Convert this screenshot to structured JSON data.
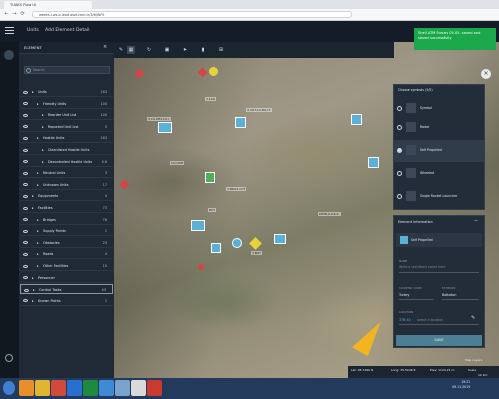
{
  "browser": {
    "tab_title": "TUAKS Flow UI",
    "url": "weeks.r.ws.b.lead.aser.com.tr/3/6/WFS"
  },
  "appbar": {
    "menu_items": [
      "Units",
      "Add Element",
      "Detail"
    ]
  },
  "panel": {
    "title": "ELEMENT",
    "search_placeholder": "Search",
    "rows": [
      {
        "label": "Units",
        "count": "163",
        "depth": 0
      },
      {
        "label": "Friendly Units",
        "count": "100",
        "depth": 1
      },
      {
        "label": "Reorder Unit List",
        "count": "100",
        "depth": 2
      },
      {
        "label": "Reported Unit List",
        "count": "0",
        "depth": 2
      },
      {
        "label": "Hostile Units",
        "count": "163",
        "depth": 1
      },
      {
        "label": "Cleanlisted Hostile Units",
        "count": "",
        "depth": 2
      },
      {
        "label": "Decontrolled Hostile Units",
        "count": "4.6",
        "depth": 2
      },
      {
        "label": "Neutral Units",
        "count": "3",
        "depth": 1
      },
      {
        "label": "Unknown Units",
        "count": "17",
        "depth": 1
      },
      {
        "label": "Equipments",
        "count": "4",
        "depth": 0
      },
      {
        "label": "Facilities",
        "count": "73",
        "depth": 0
      },
      {
        "label": "Bridges",
        "count": "78",
        "depth": 1
      },
      {
        "label": "Supply Points",
        "count": "1",
        "depth": 1
      },
      {
        "label": "Obstacles",
        "count": "23",
        "depth": 1
      },
      {
        "label": "Roads",
        "count": "4",
        "depth": 1
      },
      {
        "label": "Other Facilities",
        "count": "10",
        "depth": 1
      },
      {
        "label": "Personnel",
        "count": "",
        "depth": 0
      },
      {
        "label": "Control Tasks",
        "count": "43",
        "depth": 0
      },
      {
        "label": "Known Points",
        "count": "1",
        "depth": 0
      }
    ]
  },
  "map": {
    "labels": [
      "3.CU.DEV.CU.I.",
      "3.1KG",
      "3.VOT.CU.BLU.T.",
      "CO.UNIT",
      "3.BRGS.CUT",
      "BOY",
      "3.BOY",
      "DEPR.LUCK.K."
    ],
    "marker_colors": {
      "hostile": "#d64545",
      "friendly": "#5ab0d8",
      "neutral": "#4fae5a",
      "unknown": "#e8d23a"
    }
  },
  "symbols": {
    "title": "Choose symbols (3/5)",
    "items": [
      {
        "label": "Symbol",
        "selected": false
      },
      {
        "label": "Radar",
        "selected": false
      },
      {
        "label": "Self Propelled",
        "selected": true
      },
      {
        "label": "Wheeled",
        "selected": false
      },
      {
        "label": "Single Rocket Launcher",
        "selected": false
      }
    ]
  },
  "element_info": {
    "title": "Element Information",
    "selected_symbol": "Self Propelled",
    "name_label": "NAME",
    "name_placeholder": "Write a unit/flea's name here",
    "country_label": "COUNTRY CODE",
    "country_value": "Turkey",
    "echelon_label": "ECHELON",
    "echelon_value": "Battalion",
    "location_label": "LOCATION",
    "location_value": "37N 40",
    "location_placeholder": "select a location",
    "save_label": "SAVE"
  },
  "toast": {
    "message": "Shell ATM Forces 05.05. saved and saved successfully"
  },
  "status": {
    "lat": "Lat: 38.7466 N",
    "lon": "Long: 35.5046 E",
    "elev": "Elev: 1124.21 m",
    "scale": "Scale",
    "map_layers": "Map Layers",
    "range": "10 km"
  },
  "taskbar": {
    "time": "19:21",
    "date": "09.11.2019"
  }
}
